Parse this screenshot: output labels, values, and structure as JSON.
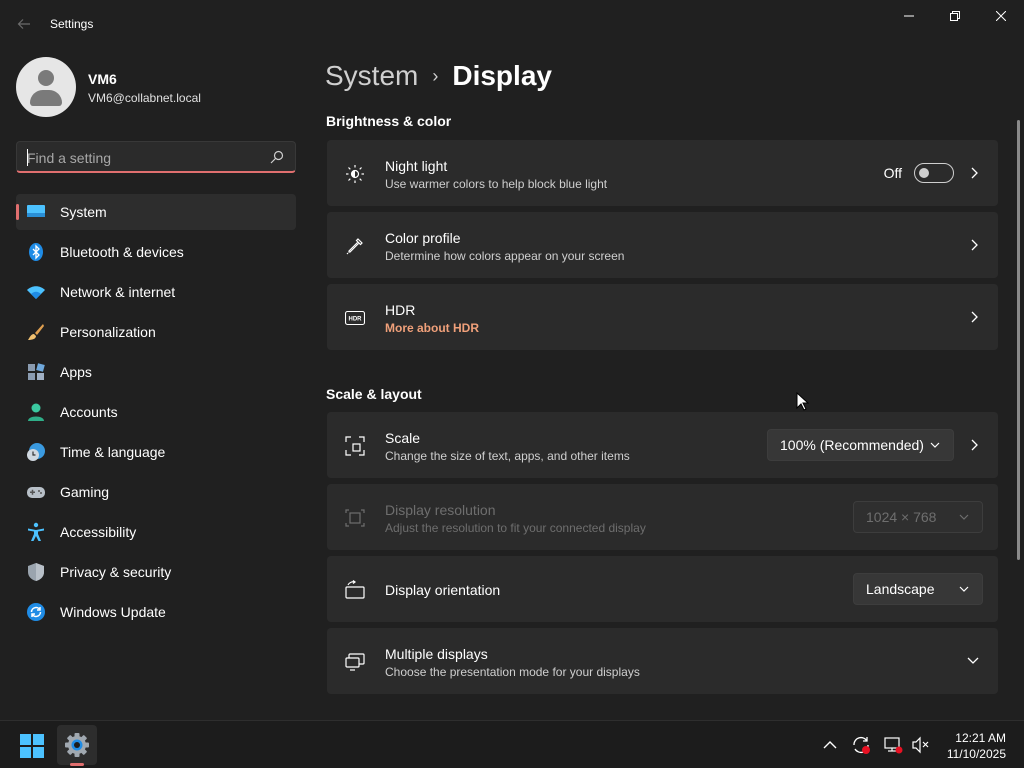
{
  "window": {
    "title": "Settings"
  },
  "profile": {
    "name": "VM6",
    "email": "VM6@collabnet.local"
  },
  "search": {
    "placeholder": "Find a setting"
  },
  "sidebar": {
    "items": [
      {
        "label": "System",
        "icon": "monitor-icon",
        "active": true
      },
      {
        "label": "Bluetooth & devices",
        "icon": "bluetooth-icon"
      },
      {
        "label": "Network & internet",
        "icon": "wifi-icon"
      },
      {
        "label": "Personalization",
        "icon": "brush-icon"
      },
      {
        "label": "Apps",
        "icon": "apps-icon"
      },
      {
        "label": "Accounts",
        "icon": "person-icon"
      },
      {
        "label": "Time & language",
        "icon": "clock-globe-icon"
      },
      {
        "label": "Gaming",
        "icon": "gamepad-icon"
      },
      {
        "label": "Accessibility",
        "icon": "accessibility-icon"
      },
      {
        "label": "Privacy & security",
        "icon": "shield-icon"
      },
      {
        "label": "Windows Update",
        "icon": "update-icon"
      }
    ]
  },
  "breadcrumb": {
    "parent": "System",
    "separator": "›",
    "current": "Display"
  },
  "sections": {
    "brightness": {
      "title": "Brightness & color",
      "night_light": {
        "title": "Night light",
        "subtitle": "Use warmer colors to help block blue light",
        "toggle_label": "Off"
      },
      "color_profile": {
        "title": "Color profile",
        "subtitle": "Determine how colors appear on your screen"
      },
      "hdr": {
        "title": "HDR",
        "link": "More about HDR"
      }
    },
    "scale_layout": {
      "title": "Scale & layout",
      "scale": {
        "title": "Scale",
        "subtitle": "Change the size of text, apps, and other items",
        "value": "100% (Recommended)"
      },
      "resolution": {
        "title": "Display resolution",
        "subtitle": "Adjust the resolution to fit your connected display",
        "value": "1024 × 768"
      },
      "orientation": {
        "title": "Display orientation",
        "value": "Landscape"
      },
      "multiple": {
        "title": "Multiple displays",
        "subtitle": "Choose the presentation mode for your displays"
      }
    }
  },
  "taskbar": {
    "time": "12:21 AM",
    "date": "11/10/2025"
  },
  "colors": {
    "accent": "#e16f6f",
    "background": "#202020",
    "card": "#2b2b2b",
    "link": "#f0a07a"
  }
}
